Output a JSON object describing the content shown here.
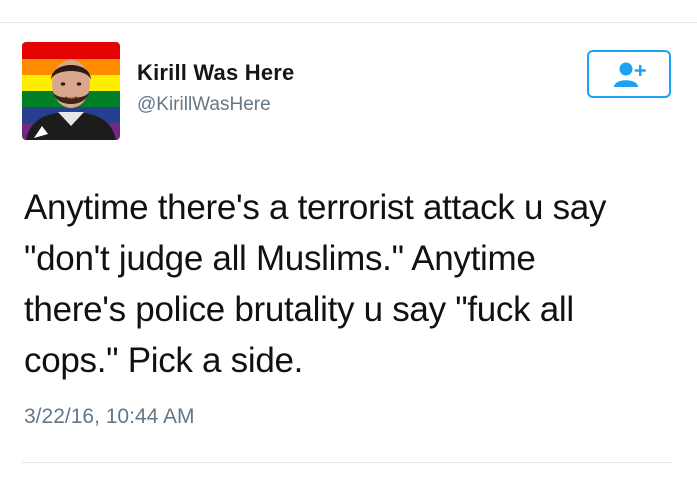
{
  "author": {
    "display_name": "Kirill Was Here",
    "handle": "@KirillWasHere"
  },
  "follow_button": {
    "icon": "add-user-icon",
    "accent_color": "#1da1f2"
  },
  "tweet": {
    "lines": [
      "Anytime there's a terrorist attack u say",
      "\"don't judge all Muslims.\" Anytime",
      "there's police brutality u say \"fuck all",
      "cops.\" Pick a side."
    ],
    "timestamp": "3/22/16, 10:44 AM"
  },
  "colors": {
    "text": "#111111",
    "secondary_text": "#657786",
    "divider": "#e1e8ed"
  }
}
